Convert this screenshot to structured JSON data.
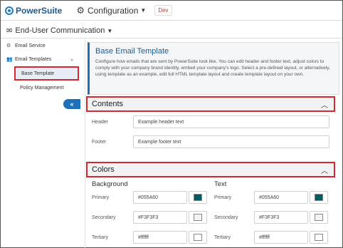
{
  "topbar": {
    "brand": "PowerSuite",
    "module": "Configuration",
    "environment": "Dev"
  },
  "section": {
    "title": "End-User Communication"
  },
  "sidebar": {
    "items": [
      {
        "label": "Email Service",
        "icon": "gear-icon"
      },
      {
        "label": "Email Templates",
        "icon": "people-icon",
        "expanded": true
      }
    ],
    "sub_items": [
      {
        "label": "Base Template",
        "active": true
      },
      {
        "label": "Policy Management",
        "active": false
      }
    ],
    "collapse_label": "«"
  },
  "info": {
    "title": "Base Email Template",
    "text": "Configure how emails that are sent by PowerSuite look like. You can edit header and footer text, adjust colors to comply with your company brand identity, embed your company's logo. Select a pre-defined layout, or alternatively, using template as an example, edit full HTML template layout and create template layout on your own."
  },
  "contents": {
    "title": "Contents",
    "header_label": "Header",
    "header_placeholder": "Example header text",
    "footer_label": "Footer",
    "footer_placeholder": "Example footer text"
  },
  "colors": {
    "title": "Colors",
    "background": {
      "title": "Background",
      "rows": [
        {
          "label": "Primary",
          "value": "#055A60",
          "swatch": "#055A60"
        },
        {
          "label": "Secondary",
          "value": "#F3F3F3",
          "swatch": "#F3F3F3"
        },
        {
          "label": "Tertiary",
          "value": "#ffffff",
          "swatch": "#ffffff"
        }
      ]
    },
    "text": {
      "title": "Text",
      "rows": [
        {
          "label": "Primary",
          "value": "#055A60",
          "swatch": "#055A60"
        },
        {
          "label": "Secondary",
          "value": "#F3F3F3",
          "swatch": "#F3F3F3"
        },
        {
          "label": "Tertiary",
          "value": "#ffffff",
          "swatch": "#ffffff"
        }
      ]
    }
  },
  "accent_color": "#1e70b8",
  "highlight_color": "#d9262c"
}
